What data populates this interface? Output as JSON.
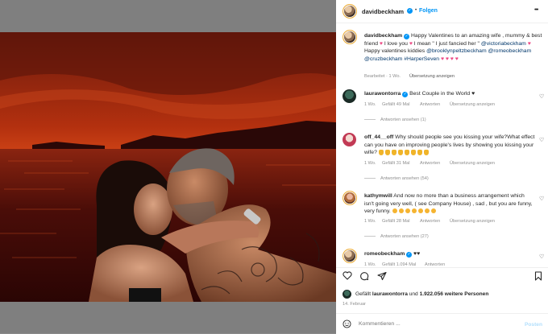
{
  "photo": {
    "description_colors": {
      "sky": "#b3300f",
      "sea": "#4a0d08"
    }
  },
  "header": {
    "username": "davidbeckham",
    "follow_label": "Folgen",
    "more_label": "•••",
    "dot": "•"
  },
  "caption": {
    "username": "davidbeckham",
    "text_1": "Happy Valentines to an amazing wife , mummy & best friend",
    "text_2": "I love you",
    "text_3": "I mean \" I just fancied her \"",
    "mention_1": "@victoriabeckham",
    "text_4": "Happy valentines kiddies",
    "mention_2": "@brooklynpeltzbeckham",
    "mention_3": "@romeobeckham",
    "mention_4": "@cruzbeckham",
    "mention_5": "#HarperSeven",
    "meta": "Bearbeitet · 1 Wo.",
    "translate": "Übersetzung anzeigen"
  },
  "comments": [
    {
      "username": "laurawontorra",
      "text": "Best Couple in the World",
      "time": "1 Wo.",
      "likes": "Gefällt 49 Mal",
      "reply": "Antworten",
      "translate": "Übersetzung anzeigen",
      "replies": "Antworten ansehen (1)"
    },
    {
      "username": "off_44__off",
      "text": "Why should people see you kissing your wife?What effect can you have on improving people's lives by showing you kissing your wife?",
      "time": "1 Wo.",
      "likes": "Gefällt 31 Mal",
      "reply": "Antworten",
      "translate": "Übersetzung anzeigen",
      "replies": "Antworten ansehen (54)"
    },
    {
      "username": "kathymwill",
      "text": "And now no more than a business arrangement which isn't going very well, ( see Company House) , sad , but you are funny, very funny.",
      "time": "1 Wo.",
      "likes": "Gefällt 28 Mal",
      "reply": "Antworten",
      "translate": "Übersetzung anzeigen",
      "replies": "Antworten ansehen (27)"
    },
    {
      "username": "romeobeckham",
      "text": "",
      "time": "1 Wo.",
      "likes": "Gefällt 1.094 Mal",
      "reply": "Antworten"
    }
  ],
  "likes": {
    "prefix": "Gefällt",
    "user": "laurawontorra",
    "middle": "und",
    "others": "1.922.056 weitere Personen",
    "date": "14. Februar"
  },
  "composer": {
    "placeholder": "Kommentieren ...",
    "post_label": "Posten"
  }
}
